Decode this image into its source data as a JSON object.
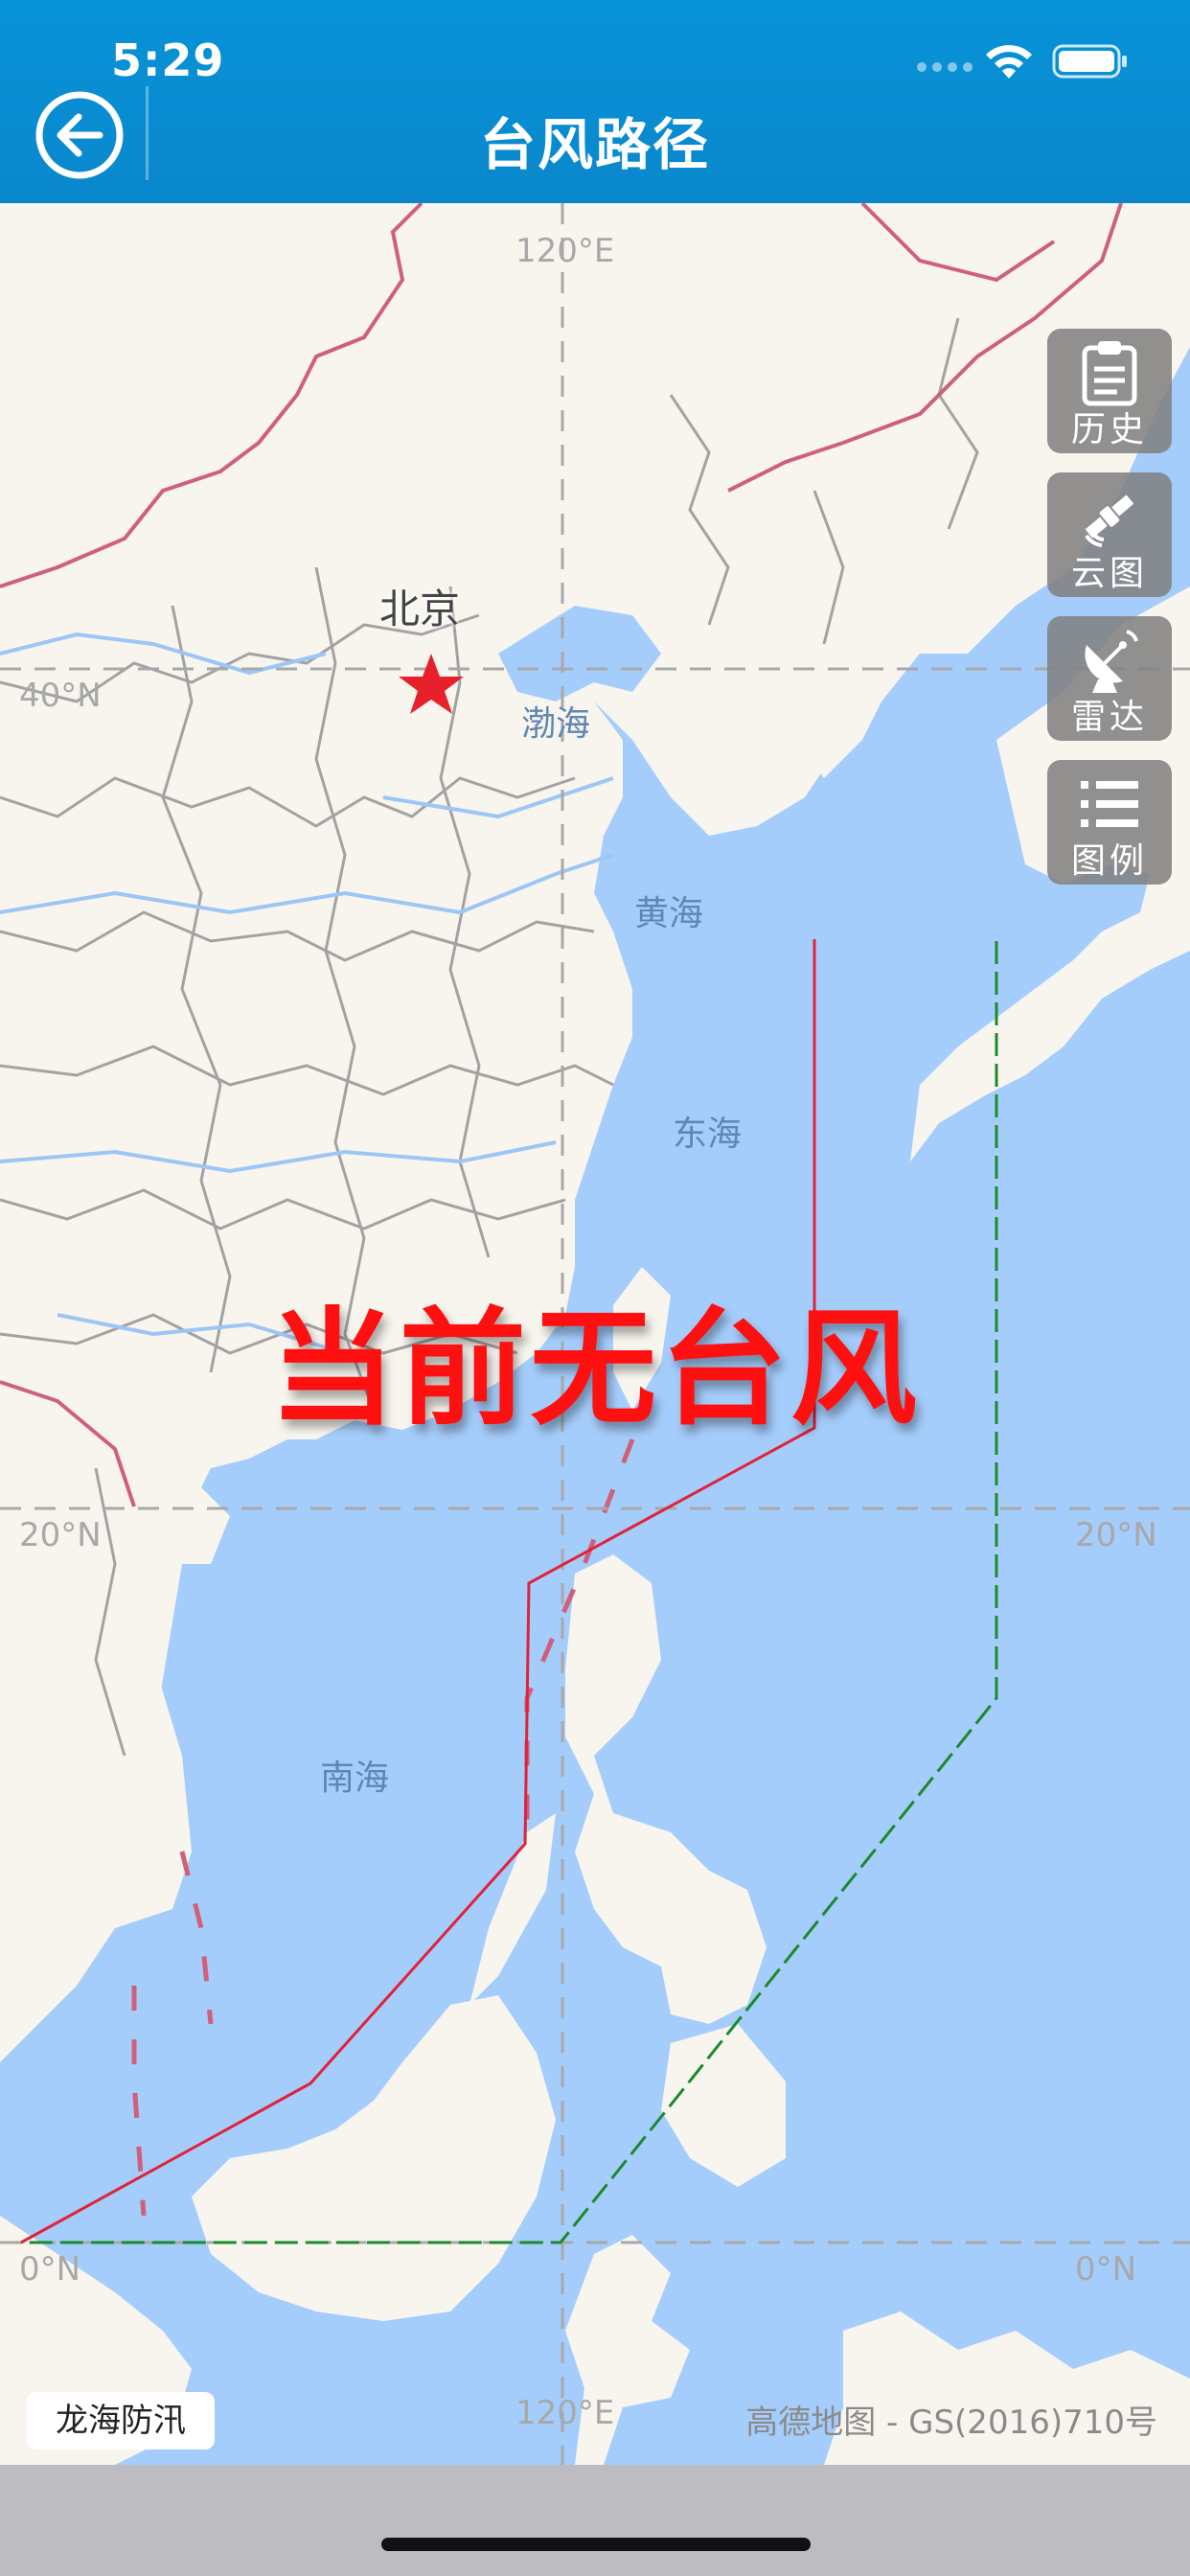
{
  "status_bar": {
    "time": "5:29"
  },
  "header": {
    "title": "台风路径"
  },
  "map": {
    "longitude_labels": [
      "120°E",
      "120°E"
    ],
    "latitude_labels": [
      "40°N",
      "20°N",
      "20°N",
      "0°N",
      "0°N"
    ],
    "city": "北京",
    "seas": [
      "渤海",
      "黄海",
      "东海",
      "南海"
    ],
    "message": "当前无台风",
    "source_badge": "龙海防汛",
    "copyright": "高德地图 - GS(2016)710号",
    "colors": {
      "sea": "#a5cdfb",
      "land": "#f8f5ef",
      "warning_line_24h": "#e0223a",
      "warning_line_48h": "#1a8a2c",
      "header": "#0a87cc"
    }
  },
  "controls": [
    {
      "label": "历史",
      "icon": "clipboard-icon"
    },
    {
      "label": "云图",
      "icon": "satellite-icon"
    },
    {
      "label": "雷达",
      "icon": "radar-dish-icon"
    },
    {
      "label": "图例",
      "icon": "list-icon"
    }
  ]
}
